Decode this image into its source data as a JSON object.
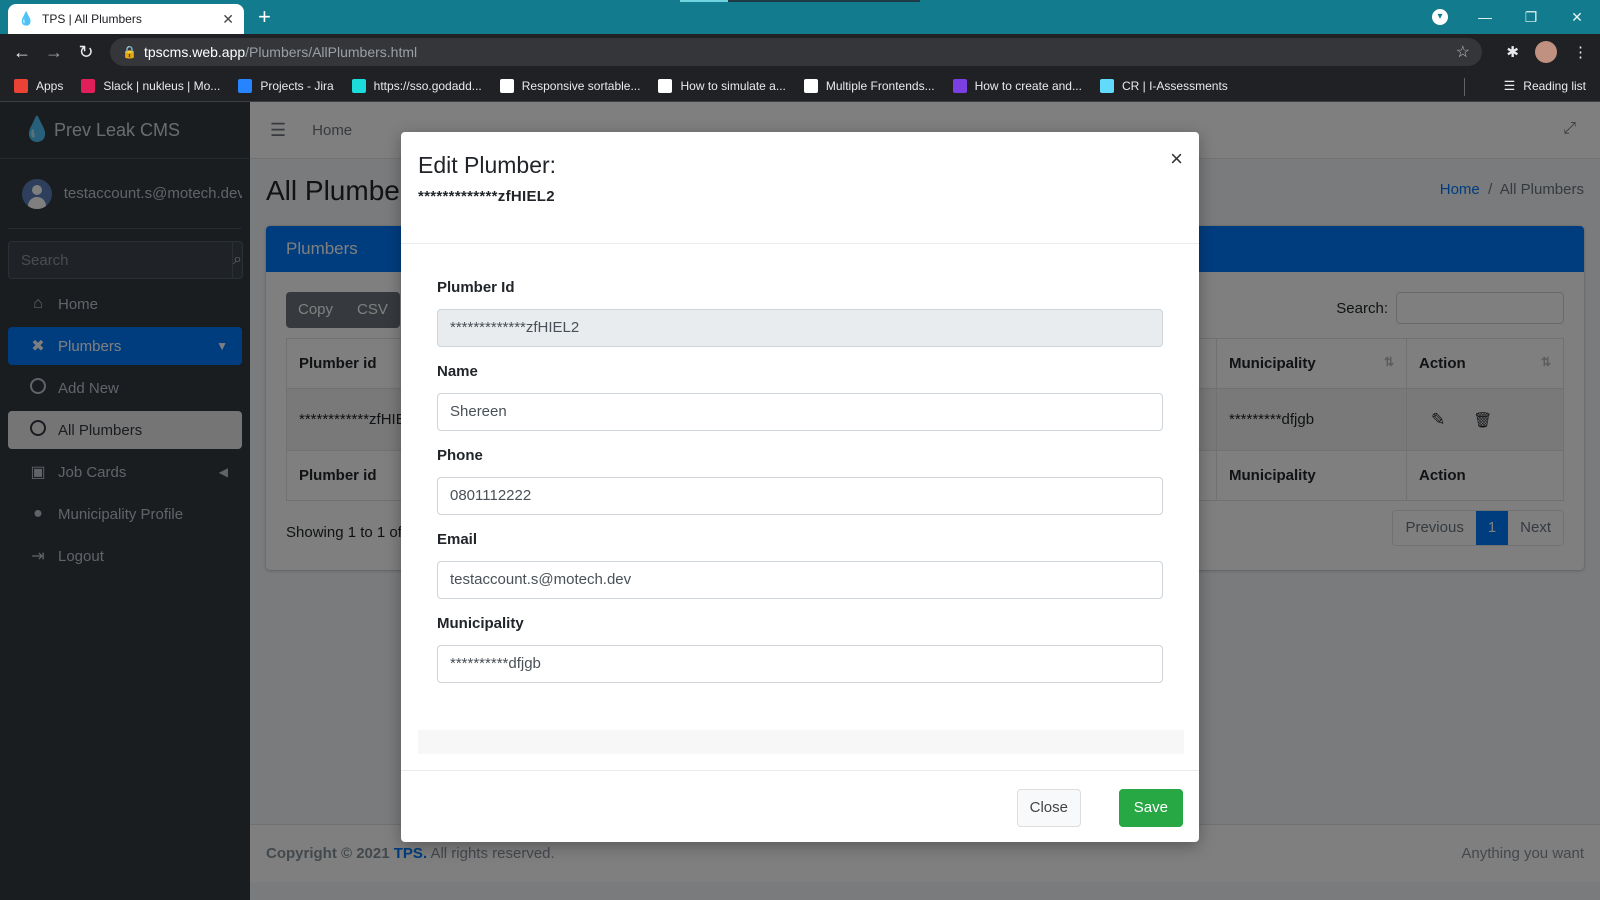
{
  "browser": {
    "tab_title": "TPS | All Plumbers",
    "url_host": "tpscms.web.app",
    "url_path": "/Plumbers/AllPlumbers.html",
    "bookmarks": [
      {
        "label": "Apps",
        "icon": "apps-grid-icon",
        "color": "#ea4335"
      },
      {
        "label": "Slack | nukleus | Mo...",
        "icon": "slack-icon",
        "color": "#e01e5a"
      },
      {
        "label": "Projects - Jira",
        "icon": "jira-icon",
        "color": "#2684ff"
      },
      {
        "label": "https://sso.godadd...",
        "icon": "godaddy-icon",
        "color": "#1bdbdb"
      },
      {
        "label": "Responsive sortable...",
        "icon": "codepen-icon",
        "color": "#ffffff"
      },
      {
        "label": "How to simulate a...",
        "icon": "medium-icon",
        "color": "#ffffff"
      },
      {
        "label": "Multiple Frontends...",
        "icon": "dev-icon",
        "color": "#ffffff"
      },
      {
        "label": "How to create and...",
        "icon": "rocket-icon",
        "color": "#7b3fe4"
      },
      {
        "label": "CR | I-Assessments",
        "icon": "react-icon",
        "color": "#61dafb"
      }
    ],
    "reading_list": "Reading list"
  },
  "sidebar": {
    "brand": "Prev Leak CMS",
    "user": "testaccount.s@motech.dev",
    "search_placeholder": "Search",
    "items": [
      {
        "label": "Home",
        "icon": "home-icon"
      },
      {
        "label": "Plumbers",
        "icon": "tools-icon"
      },
      {
        "label": "Add New",
        "icon": "circle-icon"
      },
      {
        "label": "All Plumbers",
        "icon": "circle-icon"
      },
      {
        "label": "Job Cards",
        "icon": "briefcase-icon"
      },
      {
        "label": "Municipality Profile",
        "icon": "user-icon"
      },
      {
        "label": "Logout",
        "icon": "logout-icon"
      }
    ]
  },
  "header": {
    "home": "Home"
  },
  "page": {
    "title": "All Plumbers",
    "breadcrumb_home": "Home",
    "breadcrumb_sep": "/",
    "breadcrumb_current": "All Plumbers",
    "card_title": "Plumbers",
    "buttons": [
      "Copy",
      "CSV"
    ],
    "search_label": "Search:",
    "columns": [
      "Plumber id",
      "Municipality",
      "Action"
    ],
    "row": {
      "plumber_id": "************zfHIEL2",
      "municipality": "*********dfjgb"
    },
    "showing": "Showing 1 to 1 of 1 entries",
    "pager": {
      "previous": "Previous",
      "current": "1",
      "next": "Next"
    }
  },
  "footer": {
    "copyright": "Copyright © 2021",
    "brand": "TPS.",
    "rights": "All rights reserved.",
    "right": "Anything you want"
  },
  "modal": {
    "title": "Edit Plumber:",
    "subtitle": "*************zfHIEL2",
    "fields": {
      "plumber_id": {
        "label": "Plumber Id",
        "value": "*************zfHIEL2"
      },
      "name": {
        "label": "Name",
        "value": "Shereen"
      },
      "phone": {
        "label": "Phone",
        "value": "0801112222"
      },
      "email": {
        "label": "Email",
        "value": "testaccount.s@motech.dev"
      },
      "municipality": {
        "label": "Municipality",
        "value": "**********dfjgb"
      }
    },
    "close_label": "Close",
    "save_label": "Save"
  },
  "colors": {
    "primary": "#007bff",
    "success": "#28a745",
    "sidebar_bg": "#343a40",
    "browser_frame": "#137b8e"
  }
}
